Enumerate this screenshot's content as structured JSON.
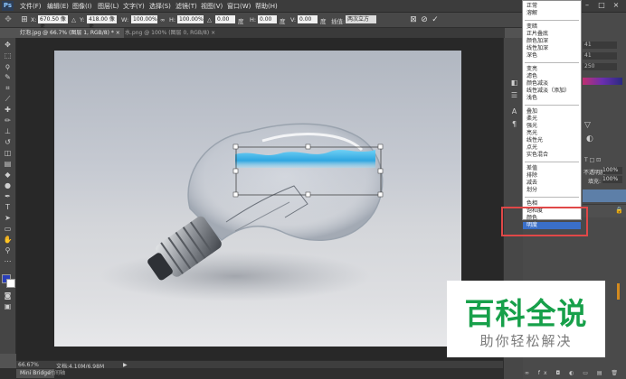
{
  "app": {
    "logo": "Ps"
  },
  "menu": [
    "文件(F)",
    "编辑(E)",
    "图像(I)",
    "图层(L)",
    "文字(Y)",
    "选择(S)",
    "滤镜(T)",
    "视图(V)",
    "窗口(W)",
    "帮助(H)"
  ],
  "options": {
    "x_value": "670.50 像素",
    "y_value": "418.00 像素",
    "w_label": "W:",
    "w_value": "100.00%",
    "h_label": "H:",
    "h_value": "100.00%",
    "angle_value": "0.00",
    "angle_unit": "度",
    "hskew_label": "H:",
    "hskew_value": "0.00",
    "hskew_unit": "度",
    "vskew_label": "V:",
    "vskew_value": "0.00",
    "vskew_unit": "度",
    "interp_label": "插值:",
    "interp_value": "两次立方"
  },
  "tabs": [
    {
      "label": "灯泡.jpg @ 66.7% (图层 1, RGB/8) * ×",
      "active": true
    },
    {
      "label": "水.png @ 100% (图层 0, RGB/8) ×",
      "active": false
    }
  ],
  "status": {
    "zoom": "66.67%",
    "doc": "文档:4.10M/6.98M"
  },
  "bottom_tabs": [
    "Mini Bridge",
    "时间轴"
  ],
  "blend_dropdown": {
    "groups": [
      [
        "正常",
        "溶解"
      ],
      [
        "变暗",
        "正片叠底",
        "颜色加深",
        "线性加深",
        "深色"
      ],
      [
        "变亮",
        "滤色",
        "颜色减淡",
        "线性减淡（添加）",
        "浅色"
      ],
      [
        "叠加",
        "柔光",
        "强光",
        "亮光",
        "线性光",
        "点光",
        "实色混合"
      ],
      [
        "差值",
        "排除",
        "减去",
        "划分"
      ],
      [
        "色相",
        "饱和度",
        "颜色",
        "明度"
      ]
    ],
    "selected": "明度"
  },
  "right_panel": {
    "values": [
      "41",
      "41",
      "250"
    ],
    "opacity_label": "不透明度:",
    "opacity_value": "100%",
    "fill_label": "填充:",
    "fill_value": "100%"
  },
  "watermark": {
    "title": "百科全说",
    "subtitle": "助你轻松解决"
  },
  "colors": {
    "accent": "#3a6fc8",
    "highlight": "#e04848",
    "brand_green": "#17a04a"
  }
}
